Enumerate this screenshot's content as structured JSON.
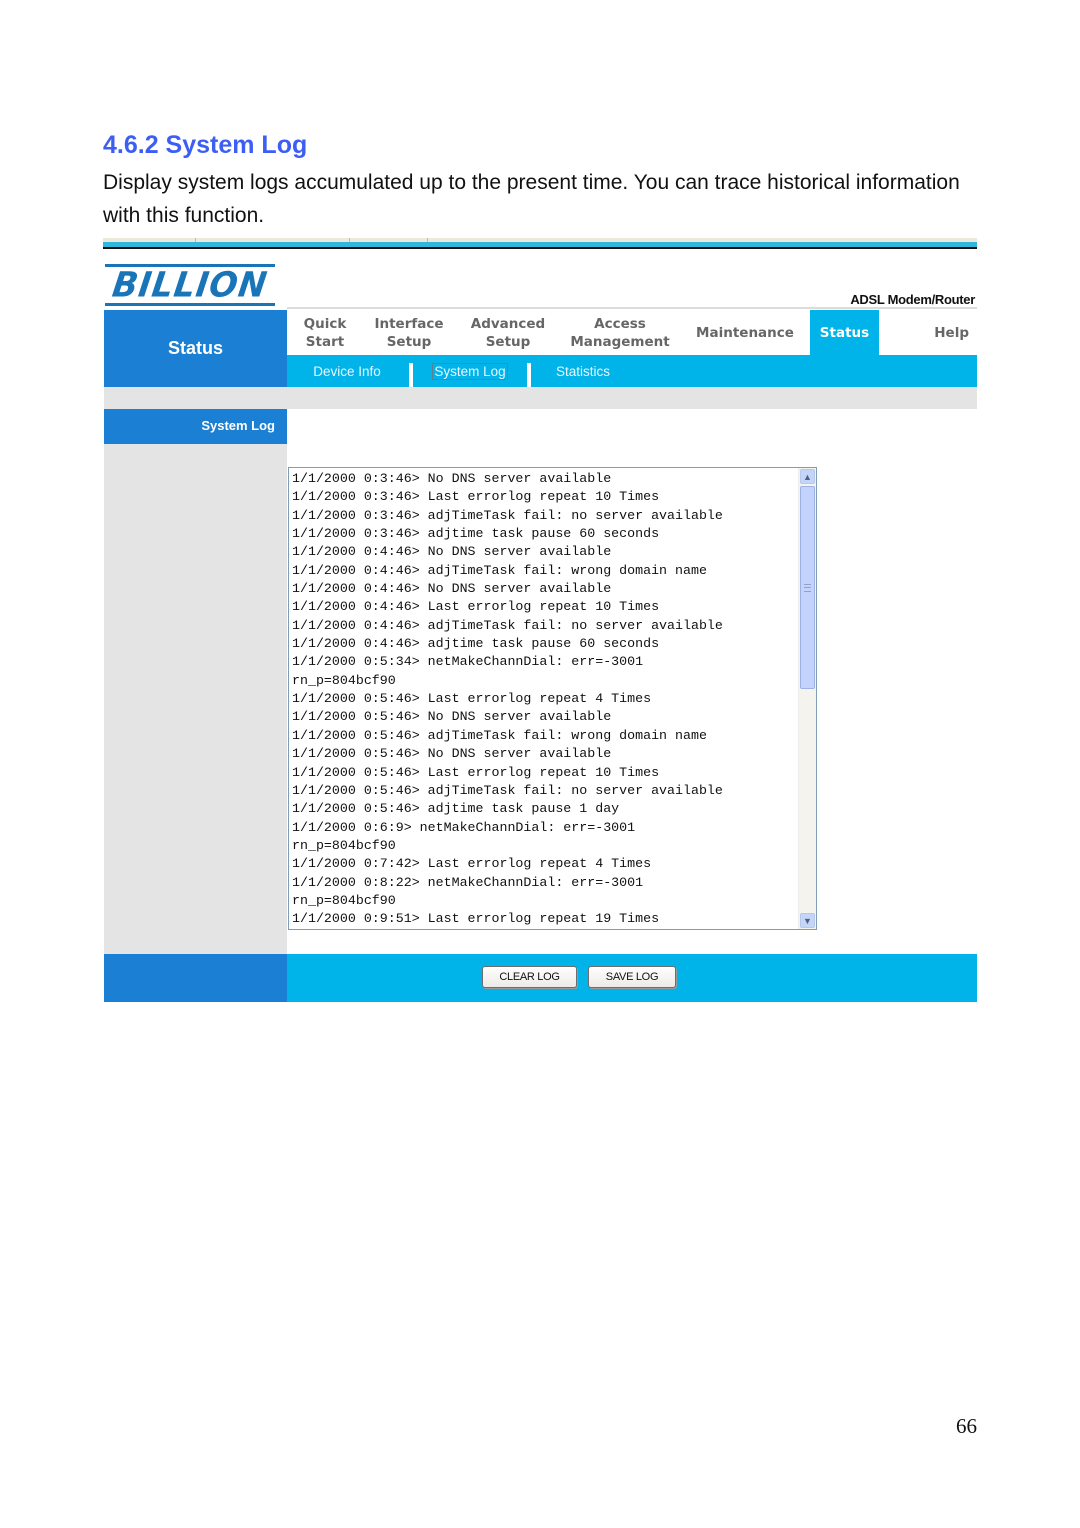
{
  "document": {
    "section_title": "4.6.2 System Log",
    "intro": "Display system logs accumulated up to the present time. You can trace historical information with this function.",
    "page_number": "66"
  },
  "router_ui": {
    "logo_text": "BILLION",
    "product_name": "ADSL Modem/Router",
    "section_label": "Status",
    "main_nav": [
      {
        "label": "Quick\nStart",
        "active": false
      },
      {
        "label": "Interface\nSetup",
        "active": false
      },
      {
        "label": "Advanced\nSetup",
        "active": false
      },
      {
        "label": "Access\nManagement",
        "active": false
      },
      {
        "label": "Maintenance",
        "active": false
      },
      {
        "label": "Status",
        "active": true
      },
      {
        "label": "Help",
        "active": false
      }
    ],
    "sub_nav": [
      {
        "label": "Device Info",
        "active": false
      },
      {
        "label": "System Log",
        "active": true
      },
      {
        "label": "Statistics",
        "active": false
      }
    ],
    "sidebar_heading": "System Log",
    "log_lines": [
      "1/1/2000 0:3:46> No DNS server available",
      "1/1/2000 0:3:46> Last errorlog repeat 10 Times",
      "1/1/2000 0:3:46> adjTimeTask fail: no server available",
      "1/1/2000 0:3:46> adjtime task pause 60 seconds",
      "1/1/2000 0:4:46> No DNS server available",
      "1/1/2000 0:4:46> adjTimeTask fail: wrong domain name",
      "1/1/2000 0:4:46> No DNS server available",
      "1/1/2000 0:4:46> Last errorlog repeat 10 Times",
      "1/1/2000 0:4:46> adjTimeTask fail: no server available",
      "1/1/2000 0:4:46> adjtime task pause 60 seconds",
      "1/1/2000 0:5:34> netMakeChannDial: err=-3001",
      "rn_p=804bcf90",
      "1/1/2000 0:5:46> Last errorlog repeat 4 Times",
      "1/1/2000 0:5:46> No DNS server available",
      "1/1/2000 0:5:46> adjTimeTask fail: wrong domain name",
      "1/1/2000 0:5:46> No DNS server available",
      "1/1/2000 0:5:46> Last errorlog repeat 10 Times",
      "1/1/2000 0:5:46> adjTimeTask fail: no server available",
      "1/1/2000 0:5:46> adjtime task pause 1 day",
      "1/1/2000 0:6:9> netMakeChannDial: err=-3001",
      "rn_p=804bcf90",
      "1/1/2000 0:7:42> Last errorlog repeat 4 Times",
      "1/1/2000 0:8:22> netMakeChannDial: err=-3001",
      "rn_p=804bcf90",
      "1/1/2000 0:9:51> Last errorlog repeat 19 Times"
    ],
    "buttons": {
      "clear_log": "CLEAR LOG",
      "save_log": "SAVE LOG"
    },
    "icons": {
      "scroll_up": "chevron-up-icon",
      "scroll_down": "chevron-down-icon"
    },
    "colors": {
      "primary_blue": "#1b7fd4",
      "accent_cyan": "#00b4ea",
      "title_blue": "#3d5ef5",
      "panel_grey": "#e4e4e4"
    }
  }
}
